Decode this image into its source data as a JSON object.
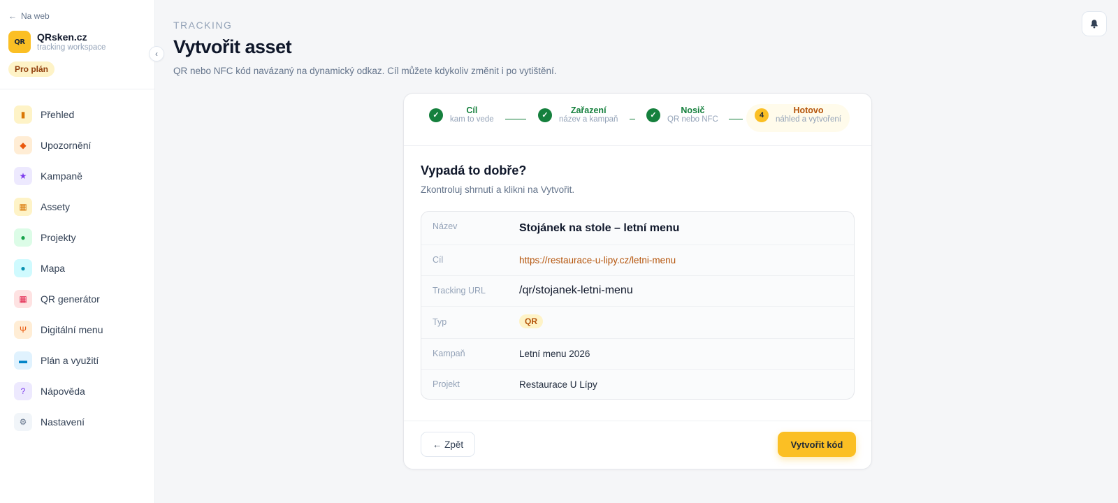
{
  "sidebar": {
    "back_label": "Na web",
    "brand": {
      "name": "QRsken.cz",
      "sub": "tracking workspace",
      "logo_text": "QR"
    },
    "plan_badge": "Pro plán",
    "items": [
      {
        "label": "Přehled",
        "icon": "bar-chart-icon",
        "bg": "#fef3c7",
        "fg": "#d97706",
        "glyph": "▮"
      },
      {
        "label": "Upozornění",
        "icon": "bell-icon",
        "bg": "#ffedd5",
        "fg": "#ea580c",
        "glyph": "◆"
      },
      {
        "label": "Kampaně",
        "icon": "star-icon",
        "bg": "#ede9fe",
        "fg": "#7c3aed",
        "glyph": "★"
      },
      {
        "label": "Assety",
        "icon": "qr-grid-icon",
        "bg": "#fef3c7",
        "fg": "#d97706",
        "glyph": "▦"
      },
      {
        "label": "Projekty",
        "icon": "users-icon",
        "bg": "#dcfce7",
        "fg": "#16a34a",
        "glyph": "●"
      },
      {
        "label": "Mapa",
        "icon": "map-pin-icon",
        "bg": "#cffafe",
        "fg": "#0891b2",
        "glyph": "●"
      },
      {
        "label": "QR generátor",
        "icon": "qr-code-icon",
        "bg": "#fee2e2",
        "fg": "#e11d48",
        "glyph": "▦"
      },
      {
        "label": "Digitální menu",
        "icon": "utensils-icon",
        "bg": "#ffedd5",
        "fg": "#ea580c",
        "glyph": "Ψ"
      },
      {
        "label": "Plán a využití",
        "icon": "credit-card-icon",
        "bg": "#e0f2fe",
        "fg": "#0284c7",
        "glyph": "▬"
      },
      {
        "label": "Nápověda",
        "icon": "help-icon",
        "bg": "#ede9fe",
        "fg": "#7c3aed",
        "glyph": "?"
      },
      {
        "label": "Nastavení",
        "icon": "gear-icon",
        "bg": "#f1f5f9",
        "fg": "#64748b",
        "glyph": "⚙"
      }
    ]
  },
  "header": {
    "section": "TRACKING",
    "title": "Vytvořit asset",
    "subtitle": "QR nebo NFC kód navázaný na dynamický odkaz. Cíl můžete kdykoliv změnit i po vytištění."
  },
  "steps": [
    {
      "title": "Cíl",
      "sub": "kam to vede",
      "state": "done"
    },
    {
      "title": "Zařazení",
      "sub": "název a kampaň",
      "state": "done"
    },
    {
      "title": "Nosič",
      "sub": "QR nebo NFC",
      "state": "done"
    },
    {
      "title": "Hotovo",
      "sub": "náhled a vytvoření",
      "state": "active",
      "number": "4"
    }
  ],
  "review": {
    "title": "Vypadá to dobře?",
    "subtitle": "Zkontroluj shrnutí a klikni na Vytvořit.",
    "rows": [
      {
        "key": "Název",
        "value": "Stojánek na stole – letní menu"
      },
      {
        "key": "Cíl",
        "value": "https://restaurace-u-lipy.cz/letni-menu"
      },
      {
        "key": "Tracking URL",
        "value": "/qr/stojanek-letni-menu"
      },
      {
        "key": "Typ",
        "value": "QR"
      },
      {
        "key": "Kampaň",
        "value": "Letní menu 2026"
      },
      {
        "key": "Projekt",
        "value": "Restaurace U Lípy"
      }
    ]
  },
  "actions": {
    "back": "← Zpět",
    "create": "Vytvořit kód"
  },
  "colors": {
    "accent": "#fbbf24",
    "success": "#15803d",
    "link": "#b45309"
  }
}
